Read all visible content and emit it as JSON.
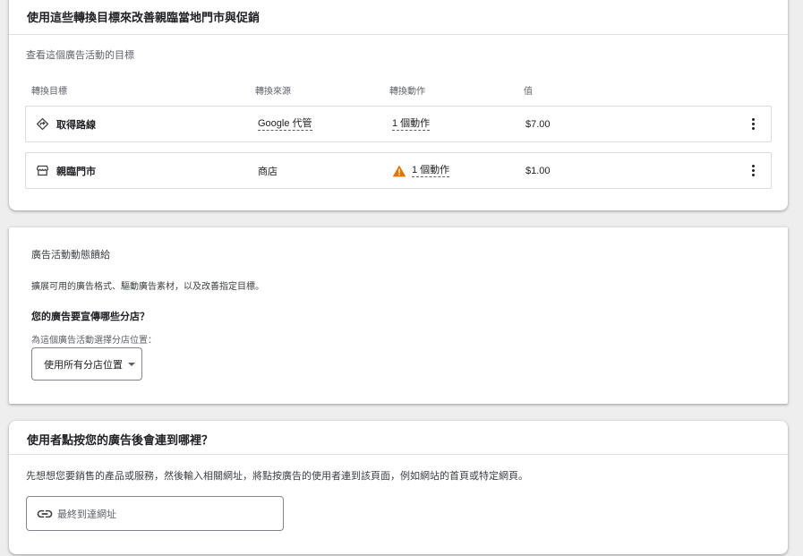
{
  "goals_card": {
    "title": "使用這些轉換目標來改善親臨當地門市與促銷",
    "subtitle": "查看這個廣告活動的目標",
    "columns": [
      "轉換目標",
      "轉換來源",
      "轉換動作",
      "值"
    ],
    "rows": [
      {
        "icon": "directions-icon",
        "name": "取得路線",
        "source": "Google 代管",
        "action": "1 個動作",
        "value": "$7.00",
        "warning": false
      },
      {
        "icon": "store-icon",
        "name": "親臨門市",
        "source": "商店",
        "action": "1 個動作",
        "value": "$1.00",
        "warning": true
      }
    ],
    "warning_color": "#e37400"
  },
  "feed_card": {
    "title": "廣告活動動態饋給",
    "description": "擴展可用的廣告格式、驅動廣告素材，以及改善指定目標。",
    "question": "您的廣告要宣傳哪些分店？",
    "select_label": "為這個廣告活動選擇分店位置：",
    "select_value": "使用所有分店位置"
  },
  "url_card": {
    "title": "使用者點按您的廣告後會連到哪裡？",
    "description": "先想想您要銷售的產品或服務，然後輸入相關網址，將點按廣告的使用者連到該頁面，例如網站的首頁或特定網頁。",
    "input_placeholder": "最終到達網址",
    "input_icon": "link-icon"
  }
}
